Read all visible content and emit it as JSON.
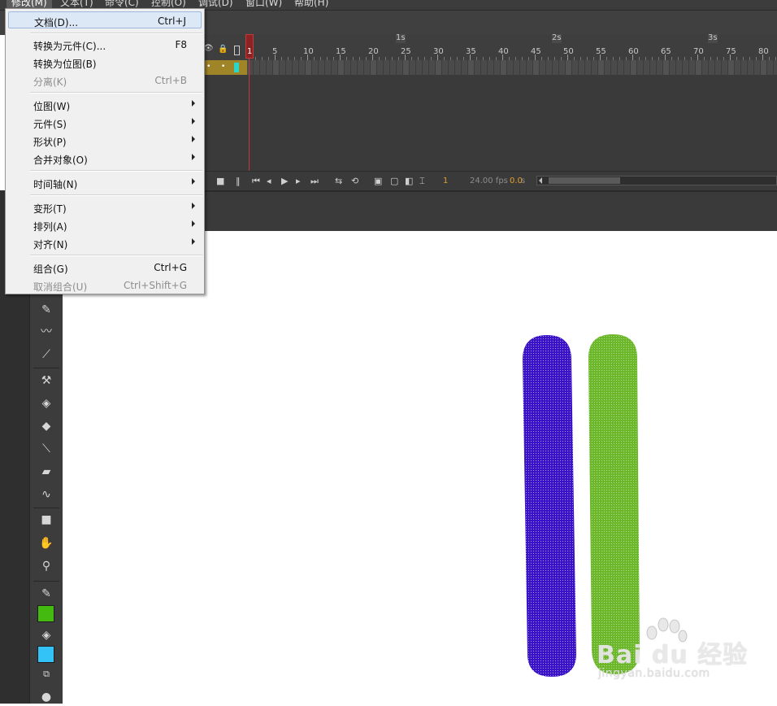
{
  "menubar": {
    "items": [
      {
        "label": "修改(M)",
        "active": true
      },
      {
        "label": "文本(T)"
      },
      {
        "label": "命令(C)"
      },
      {
        "label": "控制(O)"
      },
      {
        "label": "调试(D)"
      },
      {
        "label": "窗口(W)"
      },
      {
        "label": "帮助(H)"
      }
    ]
  },
  "modify_menu": {
    "items": [
      {
        "label": "文档(D)...",
        "shortcut": "Ctrl+J",
        "highlighted": true
      },
      {
        "label": "转换为元件(C)...",
        "shortcut": "F8"
      },
      {
        "label": "转换为位图(B)",
        "shortcut": ""
      },
      {
        "label": "分离(K)",
        "shortcut": "Ctrl+B",
        "disabled": true
      },
      {
        "label": "位图(W)",
        "submenu": true
      },
      {
        "label": "元件(S)",
        "submenu": true
      },
      {
        "label": "形状(P)",
        "submenu": true
      },
      {
        "label": "合并对象(O)",
        "submenu": true
      },
      {
        "label": "时间轴(N)",
        "submenu": true
      },
      {
        "label": "变形(T)",
        "submenu": true
      },
      {
        "label": "排列(A)",
        "submenu": true
      },
      {
        "label": "对齐(N)",
        "submenu": true
      },
      {
        "label": "组合(G)",
        "shortcut": "Ctrl+G"
      },
      {
        "label": "取消组合(U)",
        "shortcut": "Ctrl+Shift+G",
        "disabled": true
      }
    ]
  },
  "timeline": {
    "seconds": [
      "1s",
      "2s",
      "3s"
    ],
    "frame_numbers": [
      "1",
      "5",
      "10",
      "15",
      "20",
      "25",
      "30",
      "35",
      "40",
      "45",
      "50",
      "55",
      "60",
      "65",
      "70",
      "75",
      "80"
    ],
    "current_frame": "1",
    "fps": "24.00 fps",
    "time_value": "0.0",
    "time_unit": "s"
  },
  "colors": {
    "stroke_swatch": "#44b910",
    "fill_swatch": "#33c3f7",
    "shape_blue": "#3a12c8",
    "shape_green": "#6cb82a"
  },
  "tools": [
    "pencil-icon",
    "brush-icon",
    "paint-brush-icon",
    "bone-icon",
    "paint-bucket-icon",
    "ink-bottle-icon",
    "eyedropper-icon",
    "eraser-icon",
    "width-tool-icon",
    "camera-icon",
    "hand-icon",
    "zoom-icon"
  ],
  "watermark": {
    "brand": "Bai du 经验",
    "url": "jingyan.baidu.com"
  }
}
